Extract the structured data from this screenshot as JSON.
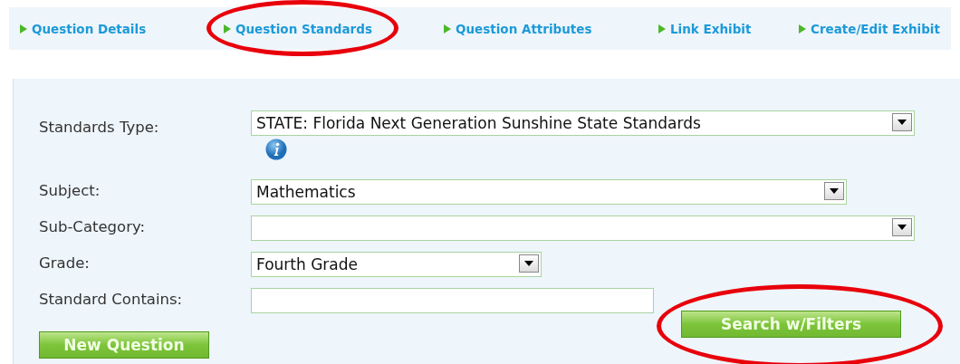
{
  "tabs": [
    {
      "label": "Question Details",
      "circled": false
    },
    {
      "label": "Question Standards",
      "circled": true
    },
    {
      "label": "Question Attributes",
      "circled": false
    },
    {
      "label": "Link Exhibit",
      "circled": false
    },
    {
      "label": "Create/Edit Exhibit",
      "circled": false
    }
  ],
  "form": {
    "fields": [
      {
        "label": "Standards Type:",
        "kind": "select",
        "value": "STATE: Florida Next Generation Sunshine State Standards",
        "info": true
      },
      {
        "label": "Subject:",
        "kind": "select",
        "value": "Mathematics"
      },
      {
        "label": "Sub-Category:",
        "kind": "select"
      },
      {
        "label": "Grade:",
        "kind": "select",
        "value": "Fourth Grade"
      },
      {
        "label": "Standard Contains:",
        "kind": "text"
      }
    ],
    "search_button": {
      "label": "Search w/Filters",
      "circled": true
    },
    "new_button": {
      "label": "New Question"
    }
  }
}
